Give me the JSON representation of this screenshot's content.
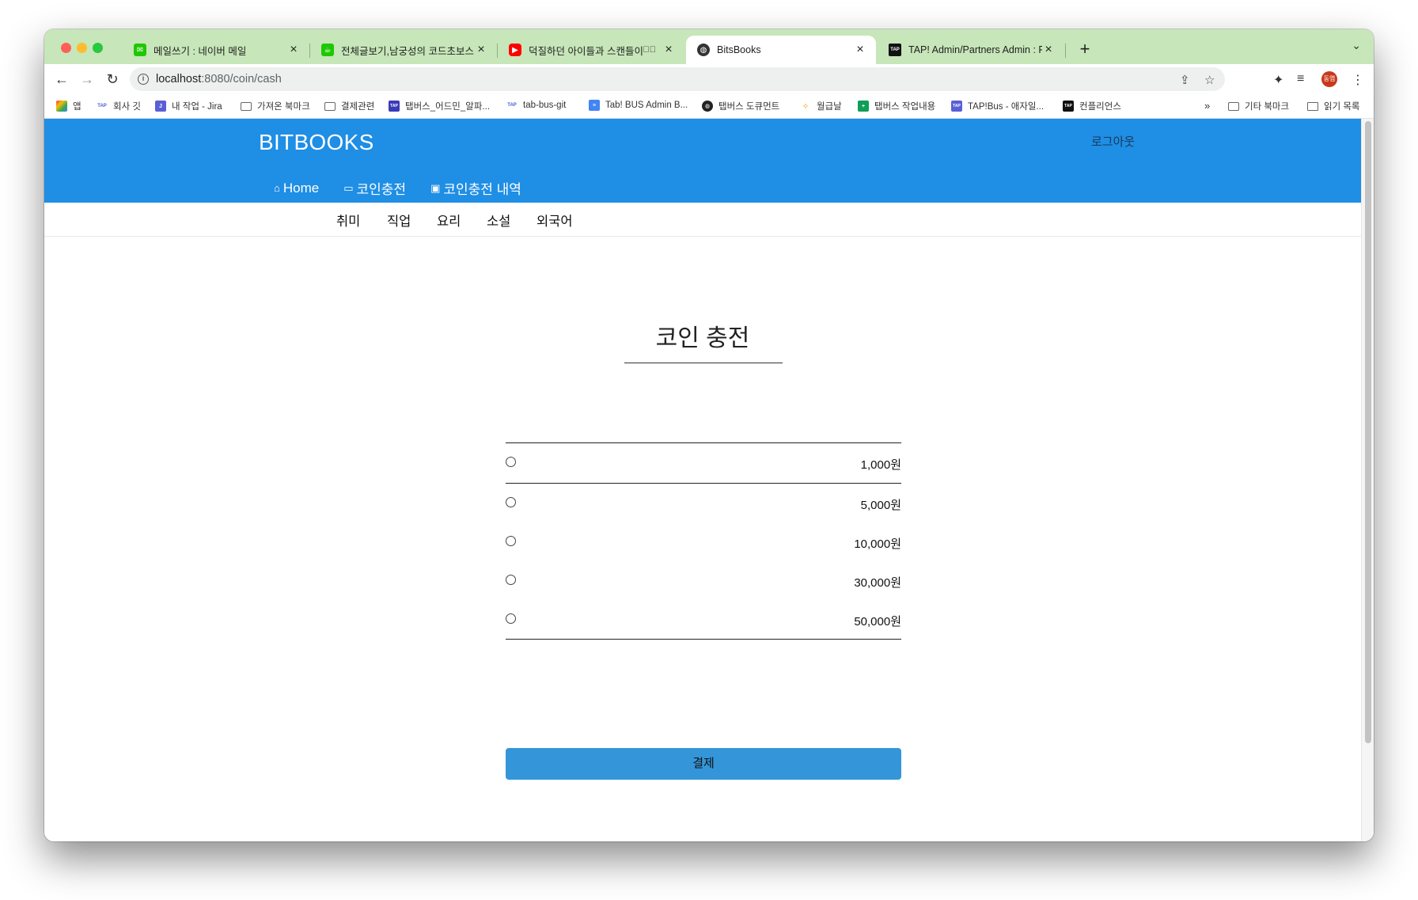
{
  "browser": {
    "tabs": [
      {
        "title": "메일쓰기 : 네이버 메일",
        "favicon_color": "#1ec800"
      },
      {
        "title": "전체글보기,남궁성의 코드초보스터디",
        "favicon_color": "#1ec800"
      },
      {
        "title": "덕질하던 아이들과 스캔들이 난 ○",
        "favicon_color": "#ff0000"
      },
      {
        "title": "BitsBooks",
        "favicon_color": "#333333"
      },
      {
        "title": "TAP! Admin/Partners Admin : P",
        "favicon_color": "#111111"
      }
    ],
    "active_tab_index": 3,
    "url_host": "localhost",
    "url_rest": ":8080/coin/cash",
    "profile_label": "동엽",
    "bookmarks": [
      "앱",
      "회사 깃",
      "내 작업 - Jira",
      "가져온 북마크",
      "결제관련",
      "탭버스_어드민_알파...",
      "tab-bus-git",
      "Tab! BUS Admin B...",
      "탭버스 도큐먼트",
      "월급날",
      "탭버스 작업내용",
      "TAP!Bus - 애자일...",
      "컨플리언스"
    ],
    "bookmarks_overflow": "»",
    "other_bookmarks": "기타 북마크",
    "reading_list": "읽기 목록"
  },
  "site": {
    "brand": "BITBOOKS",
    "logout": "로그아웃",
    "nav": [
      {
        "label": "Home",
        "icon": "home-icon"
      },
      {
        "label": "코인충전",
        "icon": "card-icon"
      },
      {
        "label": "코인충전 내역",
        "icon": "wallet-icon"
      }
    ],
    "categories": [
      "취미",
      "직업",
      "요리",
      "소설",
      "외국어"
    ],
    "accent_color": "#1f8ee5"
  },
  "coin": {
    "heading": "코인 충전",
    "amounts": [
      "1,000원",
      "5,000원",
      "10,000원",
      "30,000원",
      "50,000원"
    ],
    "pay_label": "결제"
  }
}
